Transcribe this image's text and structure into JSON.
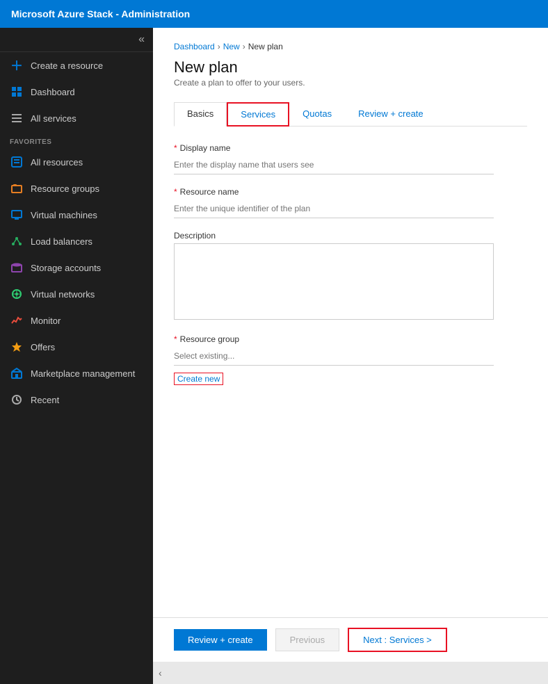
{
  "topbar": {
    "title": "Microsoft Azure Stack - Administration"
  },
  "sidebar": {
    "collapse_icon": "«",
    "items": [
      {
        "id": "create-resource",
        "label": "Create a resource",
        "icon_type": "plus"
      },
      {
        "id": "dashboard",
        "label": "Dashboard",
        "icon_type": "dashboard"
      },
      {
        "id": "all-services",
        "label": "All services",
        "icon_type": "services"
      },
      {
        "id": "favorites-label",
        "label": "FAVORITES",
        "type": "section"
      },
      {
        "id": "all-resources",
        "label": "All resources",
        "icon_type": "resources"
      },
      {
        "id": "resource-groups",
        "label": "Resource groups",
        "icon_type": "rg"
      },
      {
        "id": "virtual-machines",
        "label": "Virtual machines",
        "icon_type": "vm"
      },
      {
        "id": "load-balancers",
        "label": "Load balancers",
        "icon_type": "lb"
      },
      {
        "id": "storage-accounts",
        "label": "Storage accounts",
        "icon_type": "storage"
      },
      {
        "id": "virtual-networks",
        "label": "Virtual networks",
        "icon_type": "vnet"
      },
      {
        "id": "monitor",
        "label": "Monitor",
        "icon_type": "monitor"
      },
      {
        "id": "offers",
        "label": "Offers",
        "icon_type": "offers"
      },
      {
        "id": "marketplace-management",
        "label": "Marketplace management",
        "icon_type": "marketplace"
      },
      {
        "id": "recent",
        "label": "Recent",
        "icon_type": "recent"
      }
    ]
  },
  "breadcrumb": {
    "items": [
      "Dashboard",
      "New",
      "New plan"
    ]
  },
  "page": {
    "title": "New plan",
    "subtitle": "Create a plan to offer to your users."
  },
  "tabs": [
    {
      "id": "basics",
      "label": "Basics",
      "active": true,
      "highlighted": false
    },
    {
      "id": "services",
      "label": "Services",
      "active": false,
      "highlighted": true
    },
    {
      "id": "quotas",
      "label": "Quotas",
      "active": false,
      "highlighted": false
    },
    {
      "id": "review-create",
      "label": "Review + create",
      "active": false,
      "highlighted": false
    }
  ],
  "form": {
    "display_name": {
      "label": "Display name",
      "placeholder": "Enter the display name that users see",
      "required": true
    },
    "resource_name": {
      "label": "Resource name",
      "placeholder": "Enter the unique identifier of the plan",
      "required": true
    },
    "description": {
      "label": "Description",
      "required": false
    },
    "resource_group": {
      "label": "Resource group",
      "placeholder": "Select existing...",
      "required": true
    },
    "create_new_label": "Create new"
  },
  "footer": {
    "review_create_label": "Review + create",
    "previous_label": "Previous",
    "next_label": "Next : Services >"
  },
  "bottom_bar": {
    "chevron": "‹"
  }
}
